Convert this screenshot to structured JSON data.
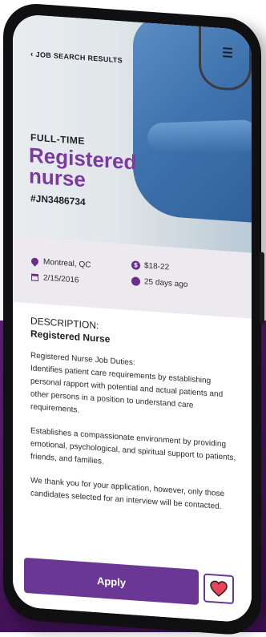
{
  "header": {
    "back_label": "JOB SEARCH RESULTS",
    "back_icon": "chevron-left-icon",
    "menu_icon": "hamburger-menu-icon"
  },
  "job": {
    "employment_type": "FULL-TIME",
    "title": "Registered nurse",
    "id": "#JN3486734",
    "location": "Montreal, QC",
    "date": "2/15/2016",
    "salary": "$18-22",
    "posted": "25 days ago"
  },
  "description": {
    "heading": "DESCRIPTION:",
    "title": "Registered Nurse",
    "duties_heading": "Registered Nurse Job Duties:",
    "paragraphs": [
      "Identifies patient care requirements by establishing personal rapport with potential and actual patients and other persons in a position to understand care requirements.",
      "Establishes a compassionate environment by providing emotional, psychological, and spiritual support to patients, friends, and families.",
      "We thank you for your application, however, only those candidates selected for an interview will be contacted."
    ]
  },
  "actions": {
    "apply_label": "Apply",
    "favorite_icon": "heart-icon"
  },
  "colors": {
    "brand_purple": "#7b3aa0",
    "button_purple": "#6b3794",
    "heart_red": "#e8455a"
  }
}
